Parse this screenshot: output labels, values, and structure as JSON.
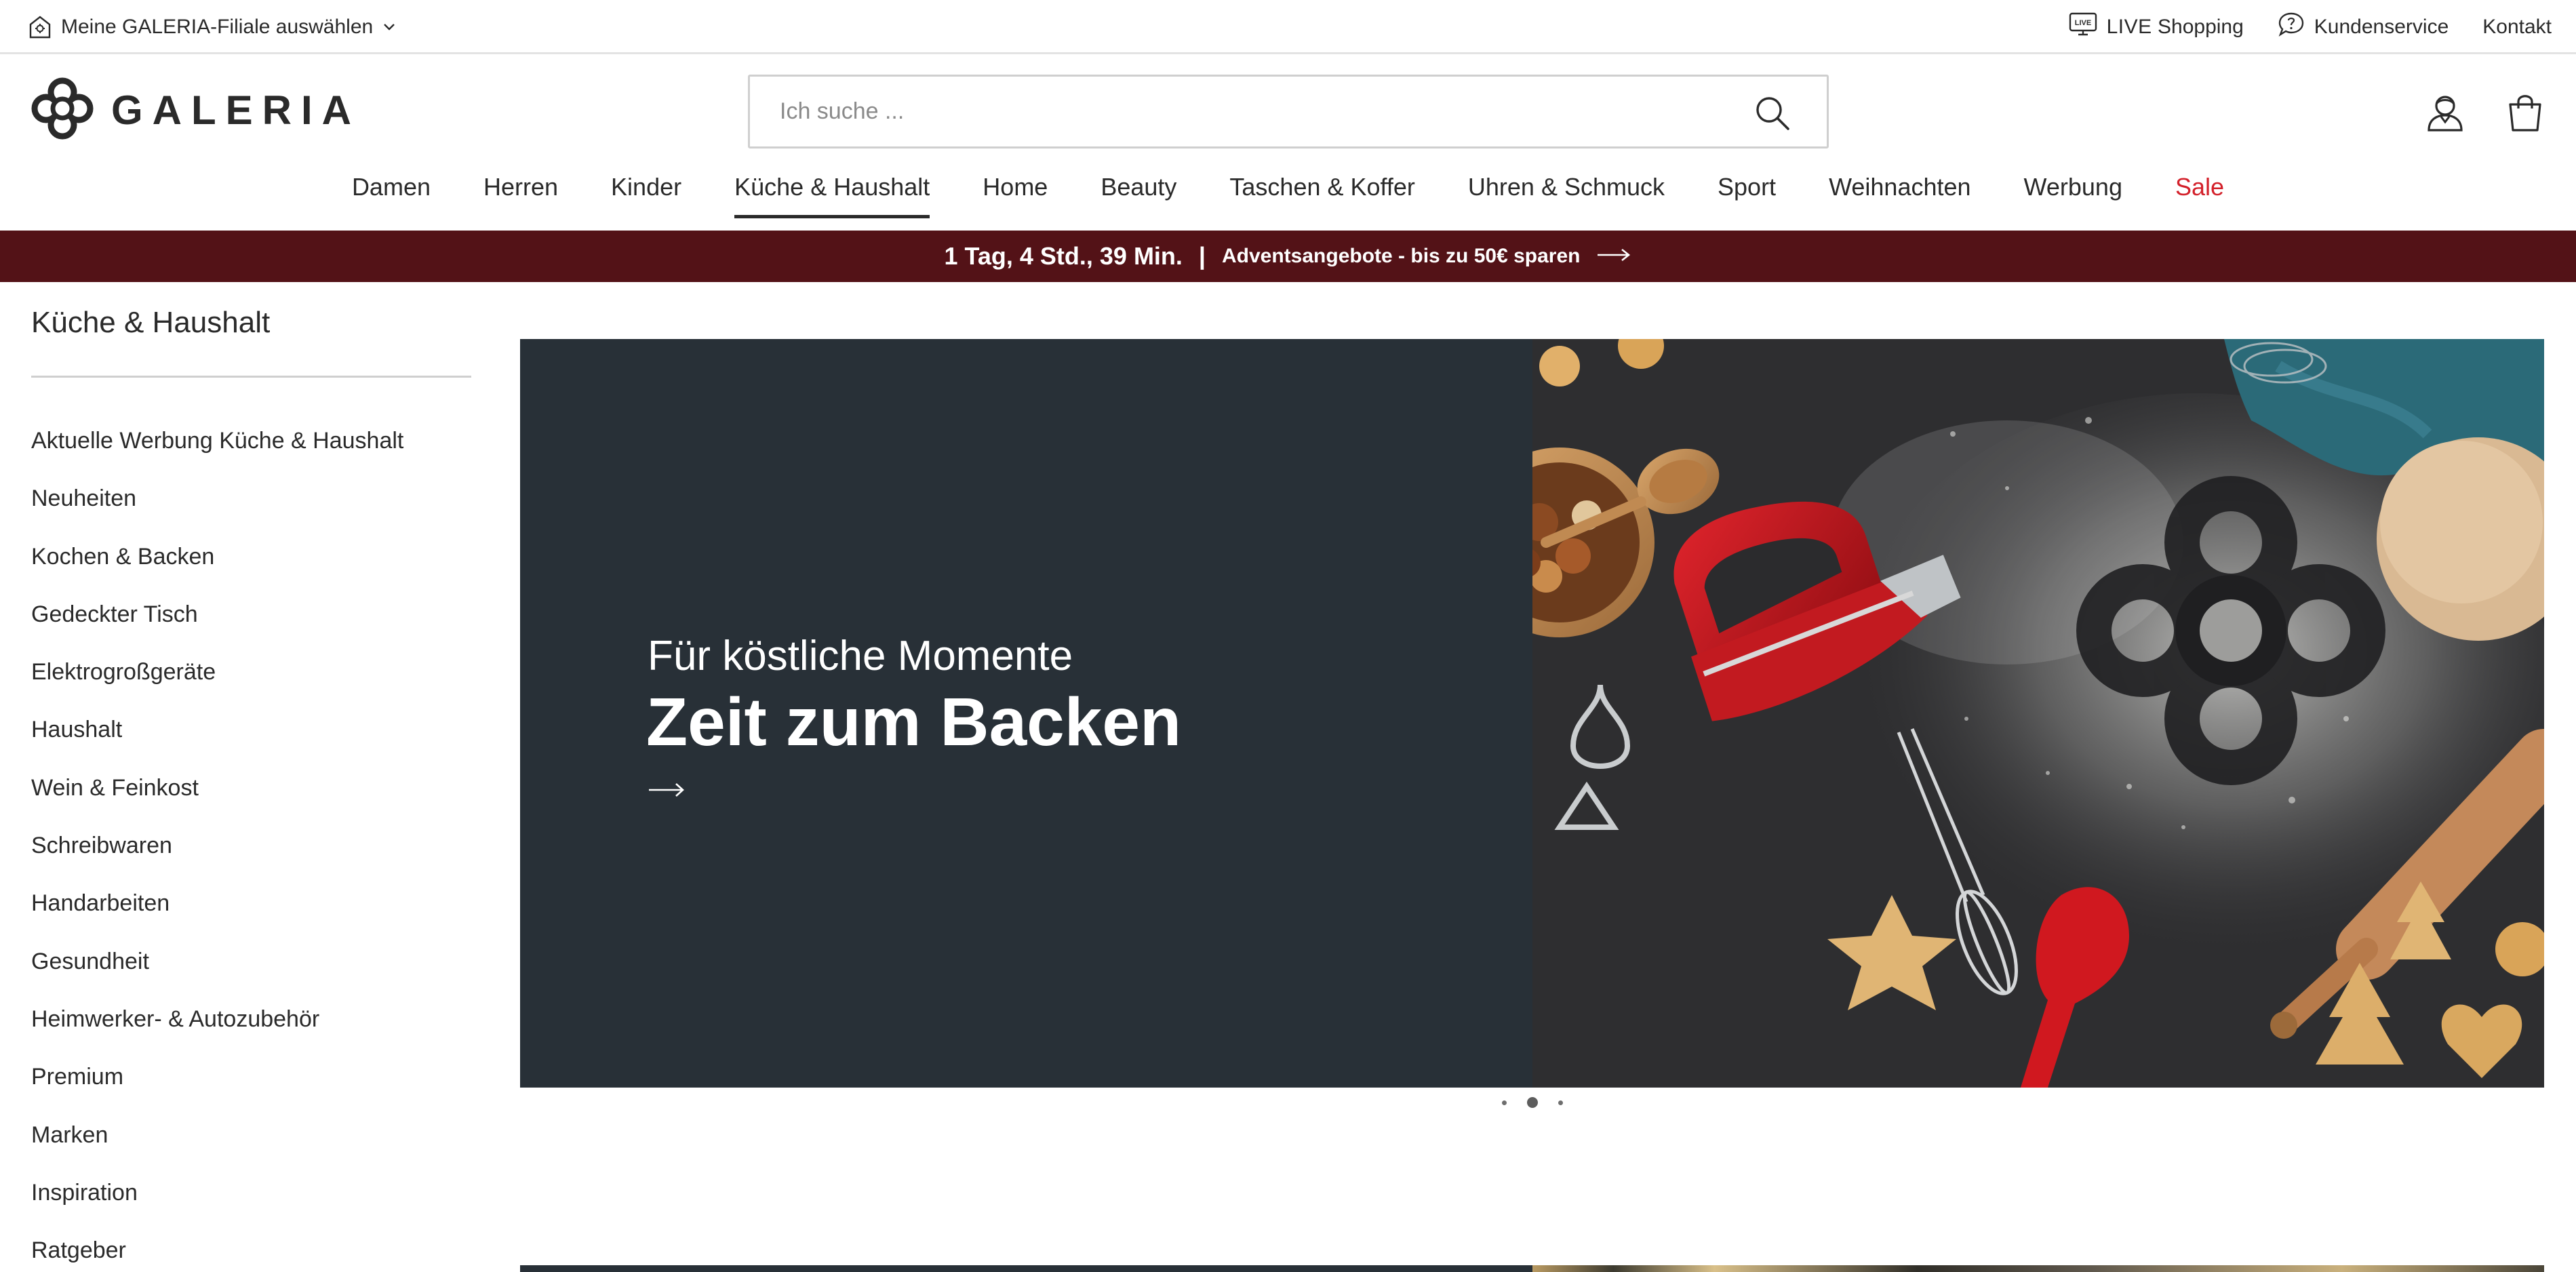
{
  "topbar": {
    "store_select_label": "Meine GALERIA-Filiale auswählen",
    "store_icon": "store-icon",
    "chevron_icon": "chevron-down-icon",
    "live_badge": "LIVE",
    "live_label": "LIVE",
    "shopping_label": "Shopping",
    "customer_service_label": "Kundenservice",
    "contact_label": "Kontakt"
  },
  "header": {
    "logo_text": "GALERIA",
    "search": {
      "placeholder": "Ich suche ...",
      "value": ""
    },
    "account_icon": "user-icon",
    "bag_icon": "shopping-bag-icon"
  },
  "nav": {
    "items": [
      {
        "label": "Damen"
      },
      {
        "label": "Herren"
      },
      {
        "label": "Kinder"
      },
      {
        "label": "Küche & Haushalt",
        "active": true
      },
      {
        "label": "Home"
      },
      {
        "label": "Beauty"
      },
      {
        "label": "Taschen & Koffer"
      },
      {
        "label": "Uhren & Schmuck"
      },
      {
        "label": "Sport"
      },
      {
        "label": "Weihnachten"
      },
      {
        "label": "Werbung"
      },
      {
        "label": "Sale",
        "highlight": true
      }
    ]
  },
  "promo": {
    "countdown": "1 Tag, 4 Std., 39 Min.",
    "separator": "|",
    "text": "Adventsangebote - bis zu 50€ sparen",
    "background": "#531217"
  },
  "sidebar": {
    "title": "Küche & Haushalt",
    "items": [
      "Aktuelle Werbung Küche & Haushalt",
      "Neuheiten",
      "Kochen & Backen",
      "Gedeckter Tisch",
      "Elektrogroßgeräte",
      "Haushalt",
      "Wein & Feinkost",
      "Schreibwaren",
      "Handarbeiten",
      "Gesundheit",
      "Heimwerker- & Autozubehör",
      "Premium",
      "Marken",
      "Inspiration",
      "Ratgeber"
    ]
  },
  "hero": {
    "subtitle": "Für köstliche Momente",
    "title": "Zeit zum Backen",
    "arrow_icon": "arrow-right-icon",
    "panel_color": "#283037",
    "image_name": "baking-scene-image"
  },
  "carousel": {
    "slides": 3,
    "active_index": 1
  },
  "colors": {
    "text": "#2a2a2a",
    "sale": "#d3202a",
    "promo_bg": "#531217",
    "hero_panel": "#283037"
  }
}
